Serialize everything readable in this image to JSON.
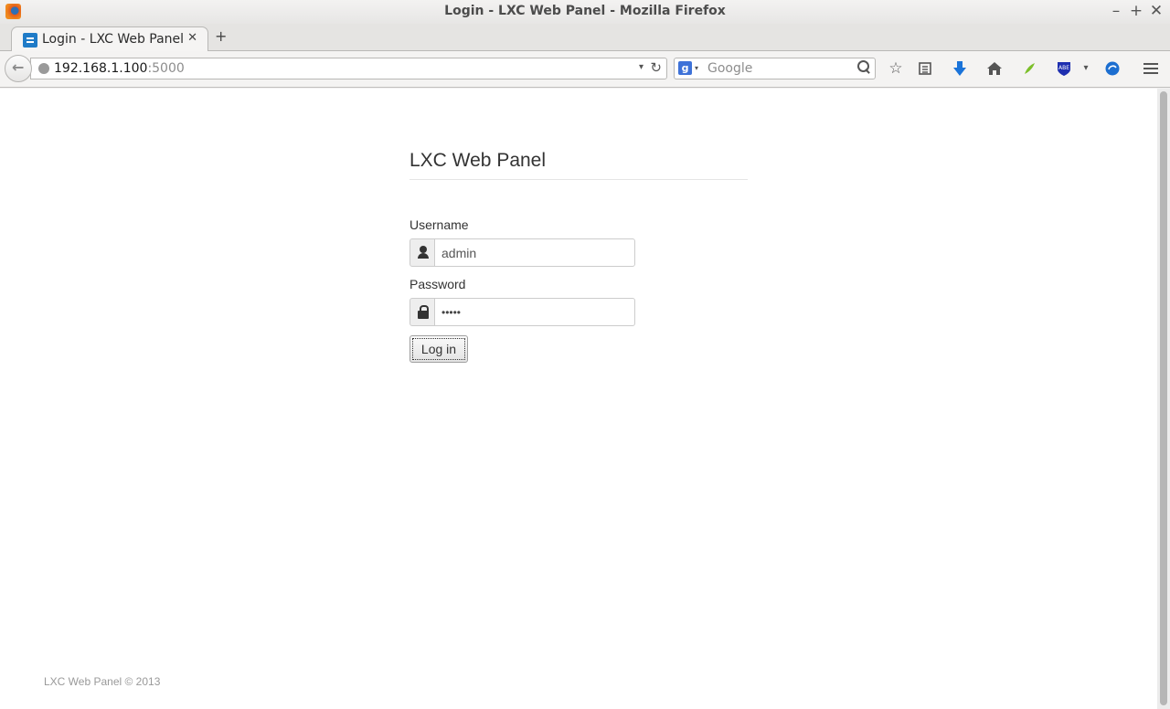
{
  "window": {
    "title": "Login - LXC Web Panel - Mozilla Firefox",
    "controls": {
      "minimize": "–",
      "maximize": "+",
      "close": "✕"
    }
  },
  "tabs": [
    {
      "label": "Login - LXC Web Panel",
      "close": "✕",
      "active": true
    }
  ],
  "new_tab": "+",
  "navbar": {
    "url_host": "192.168.1.100",
    "url_port": ":5000",
    "url_dropdown": "▾",
    "reload": "↻",
    "search_engine": "g",
    "search_dropdown": "▾",
    "search_placeholder": "Google",
    "icons": [
      "bookmark-star-icon",
      "reading-list-icon",
      "downloads-icon",
      "home-icon",
      "leaf-icon",
      "abe-icon",
      "sync-icon",
      "menu-icon"
    ]
  },
  "page": {
    "heading": "LXC Web Panel",
    "username_label": "Username",
    "username_value": "admin",
    "password_label": "Password",
    "password_value": "•••••",
    "login_button": "Log in",
    "footer": "LXC Web Panel © 2013"
  },
  "colors": {
    "accent_blue": "#1f7bc7",
    "text": "#333333",
    "footer_text": "#999999"
  }
}
